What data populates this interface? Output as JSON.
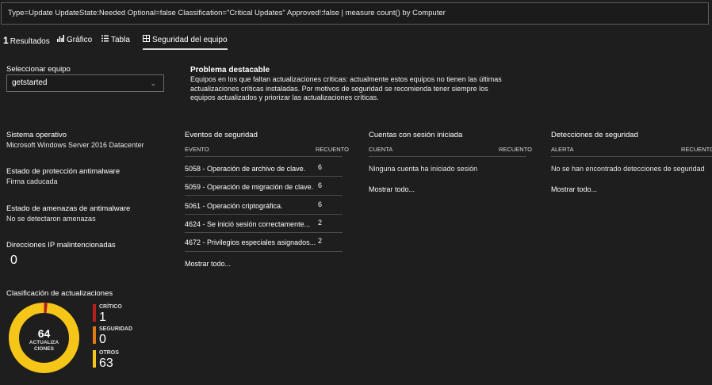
{
  "query": "Type=Update UpdateState:Needed Optional=false Classification=\"Critical Updates\" Approved!:false | measure count() by Computer",
  "tabs": [
    {
      "count": "1",
      "label": "Resultados"
    },
    {
      "label": "Gráfico",
      "icon": "bar-chart-icon"
    },
    {
      "label": "Tabla",
      "icon": "table-icon"
    },
    {
      "label": "Seguridad del equipo",
      "icon": "grid-icon",
      "active": true
    }
  ],
  "computer_select": {
    "label": "Seleccionar equipo",
    "value": "getstarted"
  },
  "problem": {
    "title": "Problema destacable",
    "text": "Equipos en los que faltan actualizaciones críticas: actualmente estos equipos no tienen las últimas actualizaciones críticas instaladas. Por motivos de seguridad se recomienda tener siempre los equipos actualizados y priorizar las actualizaciones críticas."
  },
  "info": {
    "os_label": "Sistema operativo",
    "os_value": "Microsoft Windows Server 2016 Datacenter",
    "antimalware_label": "Estado de protección antimalware",
    "antimalware_value": "Firma caducada",
    "threats_label": "Estado de amenazas de antimalware",
    "threats_value": "No se detectaron amenazas",
    "ips_label": "Direcciones IP malintencionadas",
    "ips_value": "0"
  },
  "security_events": {
    "title": "Eventos de seguridad",
    "col_event": "EVENTO",
    "col_count": "RECUENTO",
    "rows": [
      {
        "name": "5058 - Operación de archivo de clave.",
        "count": "6"
      },
      {
        "name": "5059 - Operación de migración de clave.",
        "count": "6"
      },
      {
        "name": "5061 - Operación criptográfica.",
        "count": "6"
      },
      {
        "name": "4624 - Se inició sesión correctamente...",
        "count": "2"
      },
      {
        "name": "4672 - Privilegios especiales asignados...",
        "count": "2"
      }
    ],
    "show_all": "Mostrar todo..."
  },
  "logged_accounts": {
    "title": "Cuentas con sesión iniciada",
    "col_account": "CUENTA",
    "col_count": "RECUENTO",
    "empty": "Ninguna cuenta ha iniciado sesión",
    "show_all": "Mostrar todo..."
  },
  "detections": {
    "title": "Detecciones de seguridad",
    "col_alert": "ALERTA",
    "col_count": "RECUENTO",
    "empty": "No se han encontrado detecciones de seguridad",
    "show_all": "Mostrar todo..."
  },
  "updates": {
    "title": "Clasificación de actualizaciones",
    "total": "64",
    "center_label_1": "ACTUALIZA",
    "center_label_2": "CIONES",
    "legend": [
      {
        "label": "CRÍTICO",
        "value": "1",
        "color": "#b81e1e"
      },
      {
        "label": "SEGURIDAD",
        "value": "0",
        "color": "#e07a12"
      },
      {
        "label": "OTROS",
        "value": "63",
        "color": "#f5c518"
      }
    ]
  }
}
